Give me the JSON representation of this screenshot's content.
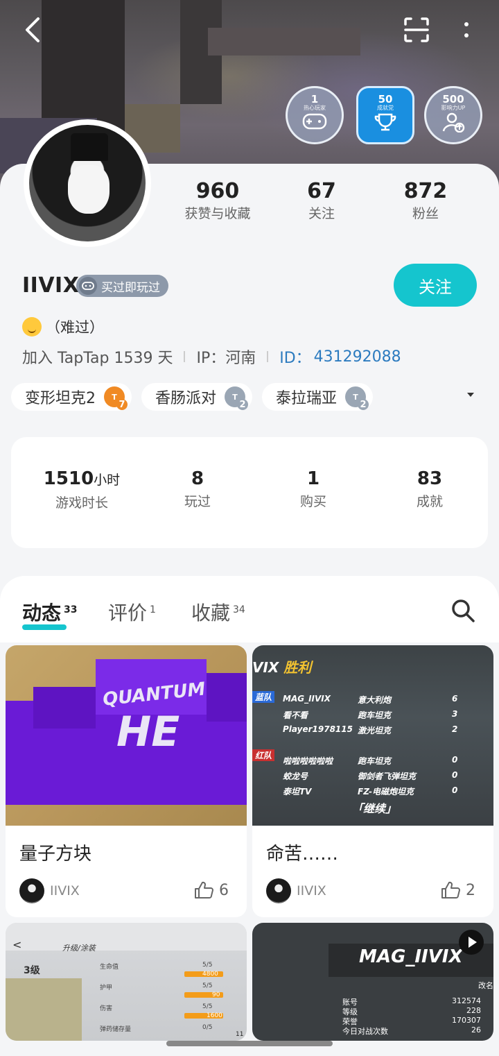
{
  "header": {
    "badges": [
      {
        "num": "1",
        "sub": "热心玩家",
        "icon": "gamepad-icon",
        "active": false
      },
      {
        "num": "50",
        "sub": "成就党",
        "icon": "trophy-icon",
        "active": true
      },
      {
        "num": "500",
        "sub": "影响力UP",
        "icon": "user-up-icon",
        "active": false
      }
    ]
  },
  "profile": {
    "stats": [
      {
        "value": "960",
        "label": "获赞与收藏"
      },
      {
        "value": "67",
        "label": "关注"
      },
      {
        "value": "872",
        "label": "粉丝"
      }
    ],
    "username": "IIVIX",
    "played_tag": "买过即玩过",
    "follow_label": "关注",
    "bio": "（难过）",
    "joined": "加入 TapTap 1539 天",
    "ip": "IP：河南",
    "id_label": "ID：",
    "id_value": "431292088",
    "games": [
      {
        "name": "变形坦克2",
        "level": "7",
        "color": "#f08a24"
      },
      {
        "name": "香肠派对",
        "level": "2",
        "color": "#9aa6b4"
      },
      {
        "name": "泰拉瑞亚",
        "level": "2",
        "color": "#9aa6b4"
      }
    ]
  },
  "summary": {
    "playtime_value": "1510",
    "playtime_unit": "小时",
    "playtime_label": "游戏时长",
    "played_value": "8",
    "played_label": "玩过",
    "bought_value": "1",
    "bought_label": "购买",
    "achieve_value": "83",
    "achieve_label": "成就"
  },
  "tabs": [
    {
      "label": "动态",
      "count": "33"
    },
    {
      "label": "评价",
      "count": "1"
    },
    {
      "label": "收藏",
      "count": "34"
    }
  ],
  "posts": [
    {
      "title": "量子方块",
      "author": "IIVIX",
      "likes": "6",
      "img_text_1": "QUANTUM",
      "img_text_2": "HE"
    },
    {
      "title": "命苦……",
      "author": "IIVIX",
      "likes": "2",
      "img_title": "VIX",
      "img_win": "胜利",
      "team_blue": "蓝队",
      "team_red": "红队",
      "rows_blue": [
        [
          "MAG_IIVIX",
          "意大利炮",
          "6"
        ],
        [
          "看不看",
          "跑车坦克",
          "3"
        ],
        [
          "Player1978115",
          "激光坦克",
          "2"
        ]
      ],
      "rows_red": [
        [
          "啦啦啦啦啦啦",
          "跑车坦克",
          "0"
        ],
        [
          "蛟龙号",
          "御剑者飞弹坦克",
          "0"
        ],
        [
          "泰坦TV",
          "FZ-电磁炮坦克",
          "0"
        ]
      ],
      "continue": "「继续」"
    },
    {
      "img_header": "升级/涂装",
      "img_level": "3级",
      "stats": [
        [
          "生命值",
          "5/5",
          "4800"
        ],
        [
          "护甲",
          "5/5",
          "90"
        ],
        [
          "伤害",
          "5/5",
          "1600"
        ],
        [
          "弹药储存量",
          "0/5",
          "11"
        ]
      ]
    },
    {
      "img_name": "MAG_IIVIX",
      "img_side": "改名",
      "rows": [
        [
          "账号",
          "312574"
        ],
        [
          "等级",
          "228"
        ],
        [
          "荣誉",
          "170307"
        ],
        [
          "今日对战次数",
          "26"
        ]
      ]
    }
  ]
}
